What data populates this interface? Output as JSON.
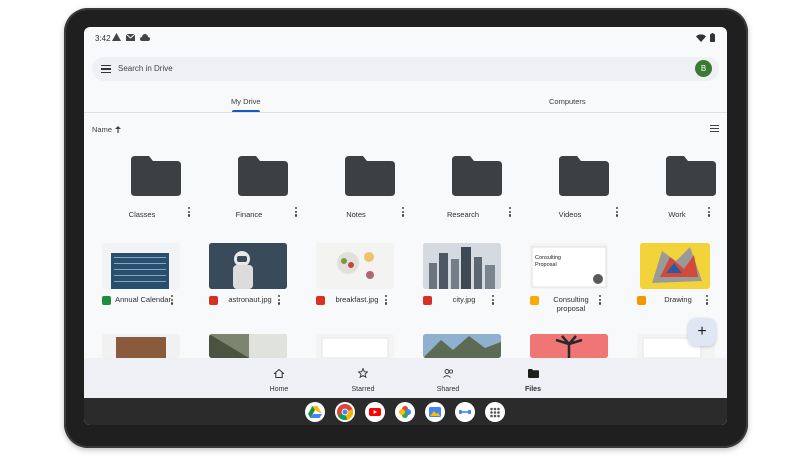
{
  "status": {
    "time": "3:42"
  },
  "search": {
    "placeholder": "Search in Drive",
    "avatar_initial": "B"
  },
  "tabs": [
    {
      "label": "My Drive",
      "active": true
    },
    {
      "label": "Computers",
      "active": false
    }
  ],
  "sort": {
    "label": "Name"
  },
  "folders": [
    {
      "name": "Classes"
    },
    {
      "name": "Finance"
    },
    {
      "name": "Notes"
    },
    {
      "name": "Research"
    },
    {
      "name": "Videos"
    },
    {
      "name": "Work"
    }
  ],
  "files": [
    {
      "name": "Annual Calendar",
      "type": "sheet"
    },
    {
      "name": "astronaut.jpg",
      "type": "image"
    },
    {
      "name": "breakfast.jpg",
      "type": "image"
    },
    {
      "name": "city.jpg",
      "type": "image"
    },
    {
      "name": "Consulting proposal",
      "type": "slides",
      "thumb_title": "Consulting Proposal"
    },
    {
      "name": "Drawing",
      "type": "drawing"
    }
  ],
  "bottom_nav": [
    {
      "label": "Home",
      "icon": "home-icon"
    },
    {
      "label": "Starred",
      "icon": "star-icon"
    },
    {
      "label": "Shared",
      "icon": "shared-icon"
    },
    {
      "label": "Files",
      "icon": "folder-icon",
      "active": true
    }
  ],
  "fab": {
    "label": "+"
  },
  "colors": {
    "accent": "#1a57c8",
    "folder": "#3c4043",
    "sheet": "#1e8e3e",
    "image": "#d93025",
    "slides": "#f9ab00"
  }
}
